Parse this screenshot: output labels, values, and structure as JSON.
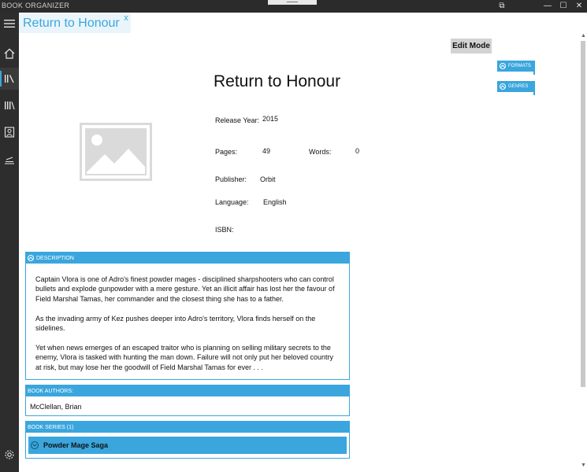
{
  "window": {
    "app_title": "BOOK ORGANIZER",
    "controls": [
      "⧉",
      "—",
      "☐",
      "✕"
    ]
  },
  "nav": {
    "items": [
      {
        "name": "menu-icon",
        "active": false
      },
      {
        "name": "home-icon",
        "active": false
      },
      {
        "name": "library-icon",
        "active": true
      },
      {
        "name": "library-alt-icon",
        "active": false
      },
      {
        "name": "author-icon",
        "active": false
      },
      {
        "name": "shelf-icon",
        "active": false
      }
    ],
    "settings_icon": "gear-icon"
  },
  "tab": {
    "label": "Return to Honour",
    "close": "x"
  },
  "toolbar": {
    "edit_label": "Edit Mode"
  },
  "side_panels": {
    "formats": "FORMATS",
    "genres": "GENRES"
  },
  "book": {
    "title": "Return to Honour",
    "release_year_label": "Release Year:",
    "release_year": "2015",
    "pages_label": "Pages:",
    "pages": "49",
    "words_label": "Words:",
    "words": "0",
    "publisher_label": "Publisher:",
    "publisher": "Orbit",
    "language_label": "Language:",
    "language": "English",
    "isbn_label": "ISBN:"
  },
  "description": {
    "header": "DESCRIPTION",
    "paragraphs": [
      "Captain Vlora is one of Adro's finest powder mages - disciplined sharpshooters who can control bullets and explode gunpowder with a mere gesture. Yet an illicit affair has lost her the favour of Field Marshal Tamas, her commander and the closest thing she has to a father.",
      "As the invading army of Kez pushes deeper into Adro's territory, Vlora finds herself on the sidelines.",
      "Yet when news emerges of an escaped traitor who is planning on selling military secrets to the enemy, Vlora is tasked with hunting the man down. Failure will not only put her beloved country at risk, but may lose her the goodwill of Field Marshal Tamas for ever . . ."
    ]
  },
  "authors": {
    "header": "BOOK AUTHORS:",
    "value": "McClellan, Brian"
  },
  "series": {
    "header": "BOOK SERIES (1)",
    "item": "Powder Mage Saga"
  },
  "colors": {
    "accent": "#3aa6dd",
    "nav_bg": "#2d2d2d",
    "titlebar_bg": "#2b2b2b"
  }
}
